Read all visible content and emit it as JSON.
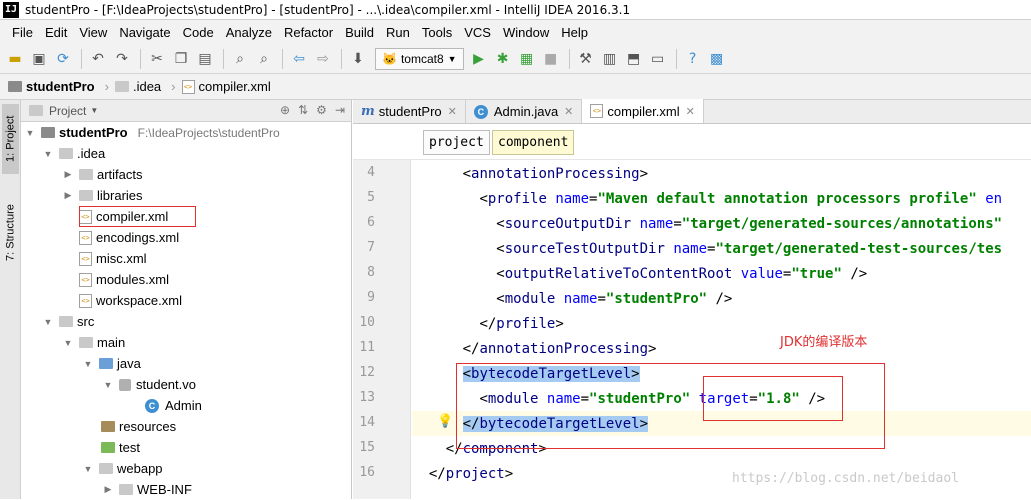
{
  "window": {
    "title": "studentPro - [F:\\IdeaProjects\\studentPro] - [studentPro] - ...\\.idea\\compiler.xml - IntelliJ IDEA 2016.3.1"
  },
  "menu": [
    "File",
    "Edit",
    "View",
    "Navigate",
    "Code",
    "Analyze",
    "Refactor",
    "Build",
    "Run",
    "Tools",
    "VCS",
    "Window",
    "Help"
  ],
  "toolbar": {
    "run_config": "tomcat8"
  },
  "navbar": {
    "crumbs": [
      "studentPro",
      ".idea",
      "compiler.xml"
    ]
  },
  "left_strip": {
    "project_tab": "1: Project",
    "structure_tab": "7: Structure"
  },
  "project_panel": {
    "header": "Project",
    "tree": [
      {
        "label": "studentPro",
        "extra": "F:\\IdeaProjects\\studentPro"
      },
      {
        "label": ".idea"
      },
      {
        "label": "artifacts"
      },
      {
        "label": "libraries"
      },
      {
        "label": "compiler.xml"
      },
      {
        "label": "encodings.xml"
      },
      {
        "label": "misc.xml"
      },
      {
        "label": "modules.xml"
      },
      {
        "label": "workspace.xml"
      },
      {
        "label": "src"
      },
      {
        "label": "main"
      },
      {
        "label": "java"
      },
      {
        "label": "student.vo"
      },
      {
        "label": "Admin"
      },
      {
        "label": "resources"
      },
      {
        "label": "test"
      },
      {
        "label": "webapp"
      },
      {
        "label": "WEB-INF"
      }
    ]
  },
  "editor_tabs": [
    "studentPro",
    "Admin.java",
    "compiler.xml"
  ],
  "xml_breadcrumb": [
    "project",
    "component"
  ],
  "line_numbers": [
    "4",
    "5",
    "6",
    "7",
    "8",
    "9",
    "10",
    "11",
    "12",
    "13",
    "14",
    "15",
    "16"
  ],
  "code": {
    "l4_tag": "annotationProcessing",
    "l5_tag": "profile",
    "l5_attr1": "name",
    "l5_val1": "\"Maven default annotation processors profile\"",
    "l5_attr2": "en",
    "l6_tag": "sourceOutputDir",
    "l6_attr": "name",
    "l6_val": "\"target/generated-sources/annotations\"",
    "l7_tag": "sourceTestOutputDir",
    "l7_attr": "name",
    "l7_val": "\"target/generated-test-sources/tes",
    "l8_tag": "outputRelativeToContentRoot",
    "l8_attr": "value",
    "l8_val": "\"true\"",
    "l9_tag": "module",
    "l9_attr": "name",
    "l9_val": "\"studentPro\"",
    "l10_tag": "profile",
    "l11_tag": "annotationProcessing",
    "l12_tag": "bytecodeTargetLevel",
    "l13_tag": "module",
    "l13_attr1": "name",
    "l13_val1": "\"studentPro\"",
    "l13_attr2": "target",
    "l13_val2": "\"1.8\"",
    "l14_tag": "bytecodeTargetLevel",
    "l15_tag": "component",
    "l16_tag": "project"
  },
  "annotation": "JDK的编译版本",
  "watermark": "https://blog.csdn.net/beidaol"
}
